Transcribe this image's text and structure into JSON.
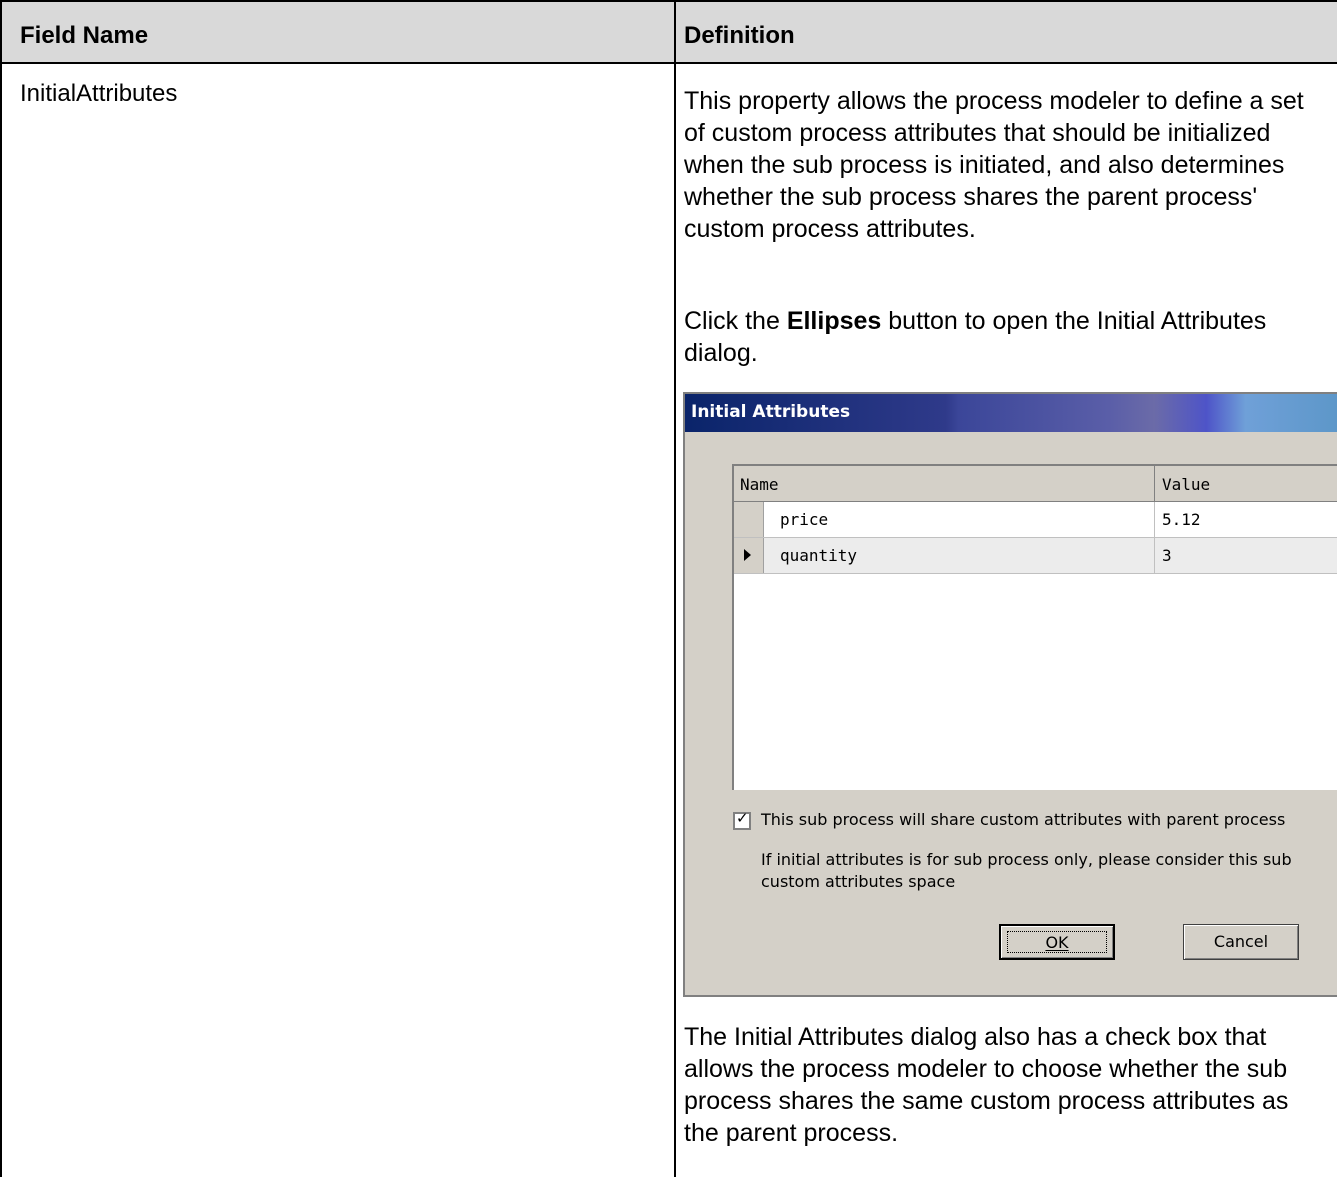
{
  "table": {
    "header": {
      "field_name": "Field Name",
      "definition": "Definition"
    },
    "row": {
      "field_name": "InitialAttributes",
      "definition_p1": "This property allows the process modeler to define a set of custom process attributes that should be initialized when the sub process is initiated, and also determines whether the sub process shares the parent process' custom process attributes.",
      "definition_p2_prefix": "Click the ",
      "definition_p2_bold": "Ellipses",
      "definition_p2_suffix": " button to open the Initial Attributes dialog.",
      "definition_p3": "The Initial Attributes dialog also has a check box that allows the process modeler to choose whether the sub process shares the same custom process attributes as the parent process."
    }
  },
  "dialog": {
    "title": "Initial Attributes",
    "grid": {
      "columns": [
        "Name",
        "Value"
      ],
      "rows": [
        {
          "name": "price",
          "value": "5.12",
          "current": false
        },
        {
          "name": "quantity",
          "value": "3",
          "current": true
        }
      ]
    },
    "checkbox_label": "This sub process will share custom attributes with parent process",
    "checkbox_checked": true,
    "info_line1": "If initial attributes is for sub process only,  please consider this sub",
    "info_line2": "custom attributes space",
    "ok_label": "OK",
    "cancel_label": "Cancel"
  }
}
